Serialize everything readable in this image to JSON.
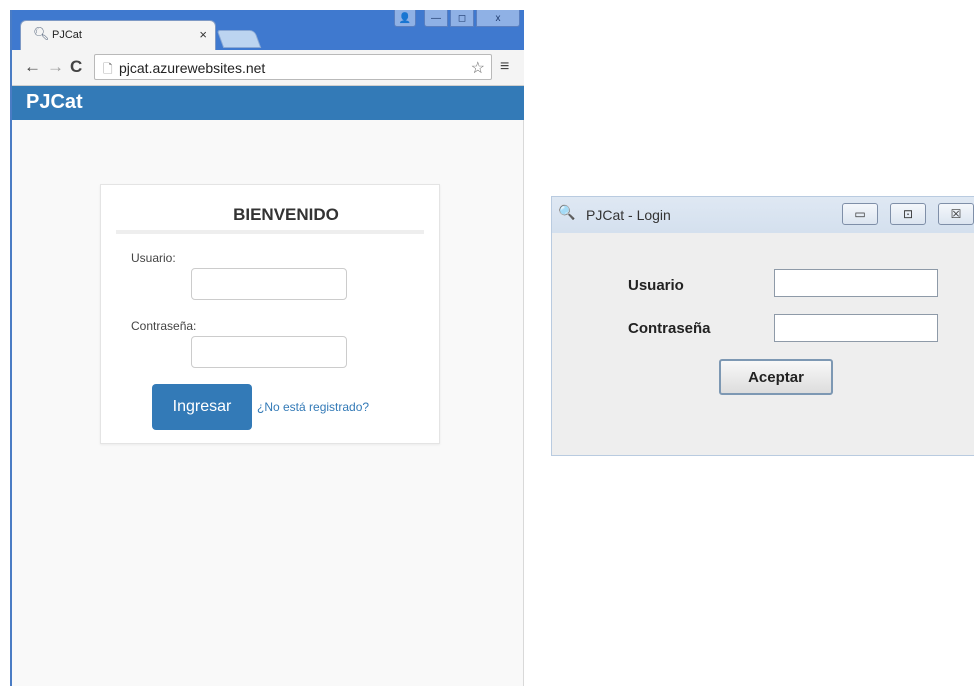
{
  "browser": {
    "tab_title": "PJCat",
    "tab_close": "×",
    "window_buttons": {
      "user": "👤",
      "minimize": "—",
      "maximize": "◻",
      "close": "x"
    },
    "nav": {
      "back": "←",
      "forward": "→",
      "reload": "C"
    },
    "url": "pjcat.azurewebsites.net",
    "star": "☆",
    "menu": "≡",
    "page_icon": "🗋"
  },
  "web_app": {
    "brand": "PJCat",
    "card_title": "BIENVENIDO",
    "username_label": "Usuario:",
    "username_value": "",
    "password_label": "Contraseña:",
    "password_value": "",
    "submit_label": "Ingresar",
    "register_link": "¿No está registrado?"
  },
  "desktop_dialog": {
    "icon": "🔍",
    "title": "PJCat - Login",
    "buttons": {
      "minimize": "▭",
      "maximize": "⊡",
      "close": "☒"
    },
    "username_label": "Usuario",
    "username_value": "",
    "password_label": "Contraseña",
    "password_value": "",
    "accept_label": "Aceptar"
  },
  "colors": {
    "browser_frame": "#3f79cf",
    "brand_bar": "#337ab7",
    "primary_button": "#337ab7",
    "link": "#337ab7",
    "dialog_titlebar": "#d9e4f1"
  }
}
